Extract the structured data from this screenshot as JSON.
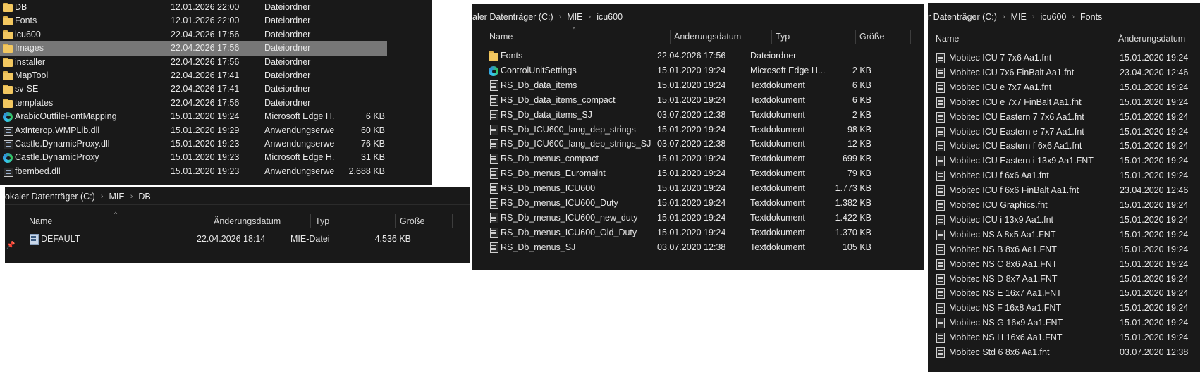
{
  "panel_a": {
    "rows": [
      {
        "name": "DB",
        "date": "12.01.2026 22:00",
        "type": "Dateiordner",
        "size": "",
        "icon": "folder"
      },
      {
        "name": "Fonts",
        "date": "12.01.2026 22:00",
        "type": "Dateiordner",
        "size": "",
        "icon": "folder"
      },
      {
        "name": "icu600",
        "date": "22.04.2026 17:56",
        "type": "Dateiordner",
        "size": "",
        "icon": "folder"
      },
      {
        "name": "Images",
        "date": "22.04.2026 17:56",
        "type": "Dateiordner",
        "size": "",
        "icon": "folder",
        "selected": true
      },
      {
        "name": "installer",
        "date": "22.04.2026 17:56",
        "type": "Dateiordner",
        "size": "",
        "icon": "folder"
      },
      {
        "name": "MapTool",
        "date": "22.04.2026 17:41",
        "type": "Dateiordner",
        "size": "",
        "icon": "folder"
      },
      {
        "name": "sv-SE",
        "date": "22.04.2026 17:41",
        "type": "Dateiordner",
        "size": "",
        "icon": "folder"
      },
      {
        "name": "templates",
        "date": "22.04.2026 17:56",
        "type": "Dateiordner",
        "size": "",
        "icon": "folder"
      },
      {
        "name": "ArabicOutfileFontMapping",
        "date": "15.01.2020 19:24",
        "type": "Microsoft Edge H...",
        "size": "6 KB",
        "icon": "edge"
      },
      {
        "name": "AxInterop.WMPLib.dll",
        "date": "15.01.2020 19:29",
        "type": "Anwendungserwe...",
        "size": "60 KB",
        "icon": "dll"
      },
      {
        "name": "Castle.DynamicProxy.dll",
        "date": "15.01.2020 19:23",
        "type": "Anwendungserwe...",
        "size": "76 KB",
        "icon": "dll"
      },
      {
        "name": "Castle.DynamicProxy",
        "date": "15.01.2020 19:23",
        "type": "Microsoft Edge H...",
        "size": "31 KB",
        "icon": "edge"
      },
      {
        "name": "fbembed.dll",
        "date": "15.01.2020 19:23",
        "type": "Anwendungserwe...",
        "size": "2.688 KB",
        "icon": "dll"
      }
    ]
  },
  "panel_b": {
    "breadcrumb": [
      "okaler Datenträger (C:)",
      "MIE",
      "DB"
    ],
    "headers": {
      "name": "Name",
      "date": "Änderungsdatum",
      "type": "Typ",
      "size": "Größe"
    },
    "rows": [
      {
        "name": "DEFAULT",
        "date": "22.04.2026 18:14",
        "type": "MIE-Datei",
        "size": "4.536 KB",
        "icon": "miefile"
      }
    ]
  },
  "panel_c": {
    "breadcrumb": [
      "aler Datenträger (C:)",
      "MIE",
      "icu600"
    ],
    "headers": {
      "name": "Name",
      "date": "Änderungsdatum",
      "type": "Typ",
      "size": "Größe"
    },
    "rows": [
      {
        "name": "Fonts",
        "date": "22.04.2026 17:56",
        "type": "Dateiordner",
        "size": "",
        "icon": "folder"
      },
      {
        "name": "ControlUnitSettings",
        "date": "15.01.2020 19:24",
        "type": "Microsoft Edge H...",
        "size": "2 KB",
        "icon": "edge"
      },
      {
        "name": "RS_Db_data_items",
        "date": "15.01.2020 19:24",
        "type": "Textdokument",
        "size": "6 KB",
        "icon": "doc"
      },
      {
        "name": "RS_Db_data_items_compact",
        "date": "15.01.2020 19:24",
        "type": "Textdokument",
        "size": "6 KB",
        "icon": "doc"
      },
      {
        "name": "RS_Db_data_items_SJ",
        "date": "03.07.2020 12:38",
        "type": "Textdokument",
        "size": "2 KB",
        "icon": "doc"
      },
      {
        "name": "RS_Db_ICU600_lang_dep_strings",
        "date": "15.01.2020 19:24",
        "type": "Textdokument",
        "size": "98 KB",
        "icon": "doc"
      },
      {
        "name": "RS_Db_ICU600_lang_dep_strings_SJ",
        "date": "03.07.2020 12:38",
        "type": "Textdokument",
        "size": "12 KB",
        "icon": "doc"
      },
      {
        "name": "RS_Db_menus_compact",
        "date": "15.01.2020 19:24",
        "type": "Textdokument",
        "size": "699 KB",
        "icon": "doc"
      },
      {
        "name": "RS_Db_menus_Euromaint",
        "date": "15.01.2020 19:24",
        "type": "Textdokument",
        "size": "79 KB",
        "icon": "doc"
      },
      {
        "name": "RS_Db_menus_ICU600",
        "date": "15.01.2020 19:24",
        "type": "Textdokument",
        "size": "1.773 KB",
        "icon": "doc"
      },
      {
        "name": "RS_Db_menus_ICU600_Duty",
        "date": "15.01.2020 19:24",
        "type": "Textdokument",
        "size": "1.382 KB",
        "icon": "doc"
      },
      {
        "name": "RS_Db_menus_ICU600_new_duty",
        "date": "15.01.2020 19:24",
        "type": "Textdokument",
        "size": "1.422 KB",
        "icon": "doc"
      },
      {
        "name": "RS_Db_menus_ICU600_Old_Duty",
        "date": "15.01.2020 19:24",
        "type": "Textdokument",
        "size": "1.370 KB",
        "icon": "doc"
      },
      {
        "name": "RS_Db_menus_SJ",
        "date": "03.07.2020 12:38",
        "type": "Textdokument",
        "size": "105 KB",
        "icon": "doc"
      }
    ]
  },
  "panel_d": {
    "breadcrumb": [
      "r Datenträger (C:)",
      "MIE",
      "icu600",
      "Fonts"
    ],
    "headers": {
      "name": "Name",
      "date": "Änderungsdatum"
    },
    "rows": [
      {
        "name": "Mobitec ICU 7 7x6 Aa1.fnt",
        "date": "15.01.2020 19:24",
        "icon": "doc"
      },
      {
        "name": "Mobitec ICU 7x6 FinBalt Aa1.fnt",
        "date": "23.04.2020 12:46",
        "icon": "doc"
      },
      {
        "name": "Mobitec ICU e 7x7 Aa1.fnt",
        "date": "15.01.2020 19:24",
        "icon": "doc"
      },
      {
        "name": "Mobitec ICU e 7x7 FinBalt Aa1.fnt",
        "date": "15.01.2020 19:24",
        "icon": "doc"
      },
      {
        "name": "Mobitec ICU Eastern 7 7x6 Aa1.fnt",
        "date": "15.01.2020 19:24",
        "icon": "doc"
      },
      {
        "name": "Mobitec ICU Eastern e 7x7 Aa1.fnt",
        "date": "15.01.2020 19:24",
        "icon": "doc"
      },
      {
        "name": "Mobitec ICU Eastern f 6x6 Aa1.fnt",
        "date": "15.01.2020 19:24",
        "icon": "doc"
      },
      {
        "name": "Mobitec ICU Eastern i 13x9 Aa1.FNT",
        "date": "15.01.2020 19:24",
        "icon": "doc"
      },
      {
        "name": "Mobitec ICU f 6x6 Aa1.fnt",
        "date": "15.01.2020 19:24",
        "icon": "doc"
      },
      {
        "name": "Mobitec ICU f 6x6 FinBalt Aa1.fnt",
        "date": "23.04.2020 12:46",
        "icon": "doc"
      },
      {
        "name": "Mobitec ICU Graphics.fnt",
        "date": "15.01.2020 19:24",
        "icon": "doc"
      },
      {
        "name": "Mobitec ICU i 13x9 Aa1.fnt",
        "date": "15.01.2020 19:24",
        "icon": "doc"
      },
      {
        "name": "Mobitec NS A 8x5 Aa1.FNT",
        "date": "15.01.2020 19:24",
        "icon": "doc"
      },
      {
        "name": "Mobitec NS B 8x6 Aa1.FNT",
        "date": "15.01.2020 19:24",
        "icon": "doc"
      },
      {
        "name": "Mobitec NS C 8x6 Aa1.FNT",
        "date": "15.01.2020 19:24",
        "icon": "doc"
      },
      {
        "name": "Mobitec NS D 8x7 Aa1.FNT",
        "date": "15.01.2020 19:24",
        "icon": "doc"
      },
      {
        "name": "Mobitec NS E 16x7 Aa1.FNT",
        "date": "15.01.2020 19:24",
        "icon": "doc"
      },
      {
        "name": "Mobitec NS F 16x8 Aa1.FNT",
        "date": "15.01.2020 19:24",
        "icon": "doc"
      },
      {
        "name": "Mobitec NS G 16x9 Aa1.FNT",
        "date": "15.01.2020 19:24",
        "icon": "doc"
      },
      {
        "name": "Mobitec NS H 16x6 Aa1.FNT",
        "date": "15.01.2020 19:24",
        "icon": "doc"
      },
      {
        "name": "Mobitec Std 6 8x6 Aa1.fnt",
        "date": "03.07.2020 12:38",
        "icon": "doc"
      }
    ]
  }
}
